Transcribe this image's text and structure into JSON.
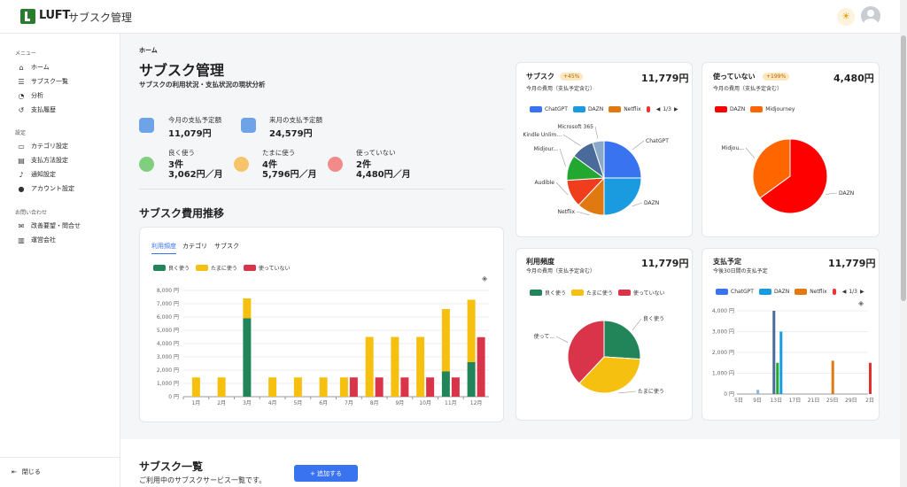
{
  "header": {
    "logo_text": "LUFT",
    "app_title": "サブスク管理",
    "theme_icon": "sun-icon",
    "avatar_icon": "user-avatar-icon"
  },
  "sidebar": {
    "menu_label": "メニュー",
    "menu_items": [
      {
        "label": "ホーム",
        "icon": "home-icon"
      },
      {
        "label": "サブスク一覧",
        "icon": "list-icon"
      },
      {
        "label": "分析",
        "icon": "pie-chart-icon"
      },
      {
        "label": "支払履歴",
        "icon": "history-icon"
      }
    ],
    "settings_label": "設定",
    "settings_items": [
      {
        "label": "カテゴリ設定",
        "icon": "folder-icon"
      },
      {
        "label": "支払方法設定",
        "icon": "card-icon"
      },
      {
        "label": "通知設定",
        "icon": "bell-icon"
      },
      {
        "label": "アカウント設定",
        "icon": "person-icon"
      }
    ],
    "contact_label": "お問い合わせ",
    "contact_items": [
      {
        "label": "改善要望・問合せ",
        "icon": "mail-icon"
      },
      {
        "label": "運営会社",
        "icon": "building-icon"
      }
    ],
    "close_label": "閉じる"
  },
  "main": {
    "breadcrumb": "ホーム",
    "title": "サブスク管理",
    "subtitle": "サブスクの利用状況・支払状況の現状分析",
    "stats": {
      "this_month_label": "今月の支払予定額",
      "this_month_value": "11,079円",
      "next_month_label": "来月の支払予定額",
      "next_month_value": "24,579円",
      "good_label": "良く使う",
      "good_count": "3件",
      "good_amount": "3,062円／月",
      "sometimes_label": "たまに使う",
      "sometimes_count": "4件",
      "sometimes_amount": "5,796円／月",
      "unused_label": "使っていない",
      "unused_count": "2件",
      "unused_amount": "4,480円／月"
    },
    "trend": {
      "title": "サブスク費用推移",
      "tabs": [
        "利用頻度",
        "カテゴリ",
        "サブスク"
      ],
      "legend": [
        "良く使う",
        "たまに使う",
        "使っていない"
      ]
    }
  },
  "colors": {
    "good": "#22855a",
    "sometimes": "#f5c010",
    "unused": "#d9344a",
    "accent": "#3a73f0"
  },
  "cards": {
    "subs": {
      "title": "サブスク",
      "badge": "+45%",
      "amount": "11,779円",
      "sub": "今月の費用（支払予定含む）",
      "legend": [
        "ChatGPT",
        "DAZN",
        "Netflix"
      ],
      "page": "1/3"
    },
    "unused": {
      "title": "使っていない",
      "badge": "+199%",
      "amount": "4,480円",
      "sub": "今月の費用（支払予定含む）",
      "legend": [
        "DAZN",
        "Midjourney"
      ]
    },
    "freq": {
      "title": "利用頻度",
      "amount": "11,779円",
      "sub": "今月の費用（支払予定含む）",
      "legend": [
        "良く使う",
        "たまに使う",
        "使っていない"
      ]
    },
    "schedule": {
      "title": "支払予定",
      "amount": "11,779円",
      "sub": "今後30日間の支払予定",
      "legend": [
        "ChatGPT",
        "DAZN",
        "Netflix"
      ],
      "page": "1/3"
    }
  },
  "list": {
    "title": "サブスク一覧",
    "subtitle": "ご利用中のサブスクサービス一覧です。",
    "add_button": "+ 追加する"
  },
  "chart_data": [
    {
      "type": "bar",
      "title": "サブスク費用推移",
      "categories": [
        "1月",
        "2月",
        "3月",
        "4月",
        "5月",
        "6月",
        "7月",
        "8月",
        "9月",
        "10月",
        "11月",
        "12月"
      ],
      "series": [
        {
          "name": "良く使う",
          "values": [
            0,
            0,
            5900,
            0,
            0,
            0,
            0,
            0,
            0,
            0,
            1900,
            2600
          ]
        },
        {
          "name": "たまに使う",
          "values": [
            1450,
            1450,
            1500,
            1450,
            1450,
            1450,
            1450,
            4500,
            4500,
            4500,
            4700,
            4700
          ]
        },
        {
          "name": "使っていない",
          "values": [
            0,
            0,
            0,
            0,
            0,
            0,
            1450,
            1450,
            1450,
            1450,
            1450,
            4480
          ]
        }
      ],
      "yticks": [
        "0 円",
        "1,000 円",
        "2,000 円",
        "3,000 円",
        "4,000 円",
        "5,000 円",
        "6,000 円",
        "7,000 円",
        "8,000 円"
      ],
      "ylim": [
        0,
        8000
      ]
    },
    {
      "type": "pie",
      "title": "サブスク",
      "labels": [
        "ChatGPT",
        "DAZN",
        "Netflix",
        "Audible",
        "Midjour...",
        "Kindle Unlim...",
        "Microsoft 365"
      ],
      "values": [
        25,
        25,
        12,
        12,
        11,
        10,
        5
      ]
    },
    {
      "type": "pie",
      "title": "使っていない",
      "labels": [
        "DAZN",
        "Midjou..."
      ],
      "values": [
        65,
        35
      ]
    },
    {
      "type": "pie",
      "title": "利用頻度",
      "labels": [
        "良く使う",
        "たまに使う",
        "使って..."
      ],
      "values": [
        26,
        36,
        38
      ]
    },
    {
      "type": "bar",
      "title": "支払予定",
      "categories": [
        "5日",
        "9日",
        "13日",
        "17日",
        "21日",
        "25日",
        "29日",
        "2日"
      ],
      "yticks": [
        "0 円",
        "1,000 円",
        "2,000 円",
        "3,000 円",
        "4,000 円"
      ],
      "ylim": [
        0,
        4000
      ],
      "series": [
        {
          "name": "ChatGPT",
          "values": [
            0,
            200,
            0,
            0,
            0,
            0,
            0,
            0
          ]
        },
        {
          "name": "Microsoft 365",
          "values": [
            0,
            0,
            4000,
            0,
            0,
            0,
            0,
            0
          ]
        },
        {
          "name": "Midjourney",
          "values": [
            0,
            0,
            1500,
            0,
            0,
            0,
            0,
            0
          ]
        },
        {
          "name": "DAZN",
          "values": [
            0,
            0,
            3000,
            0,
            0,
            0,
            0,
            0
          ]
        },
        {
          "name": "Netflix",
          "values": [
            0,
            0,
            0,
            0,
            0,
            1600,
            0,
            0
          ]
        },
        {
          "name": "Audible",
          "values": [
            0,
            0,
            0,
            0,
            0,
            0,
            0,
            1500
          ]
        }
      ]
    }
  ]
}
